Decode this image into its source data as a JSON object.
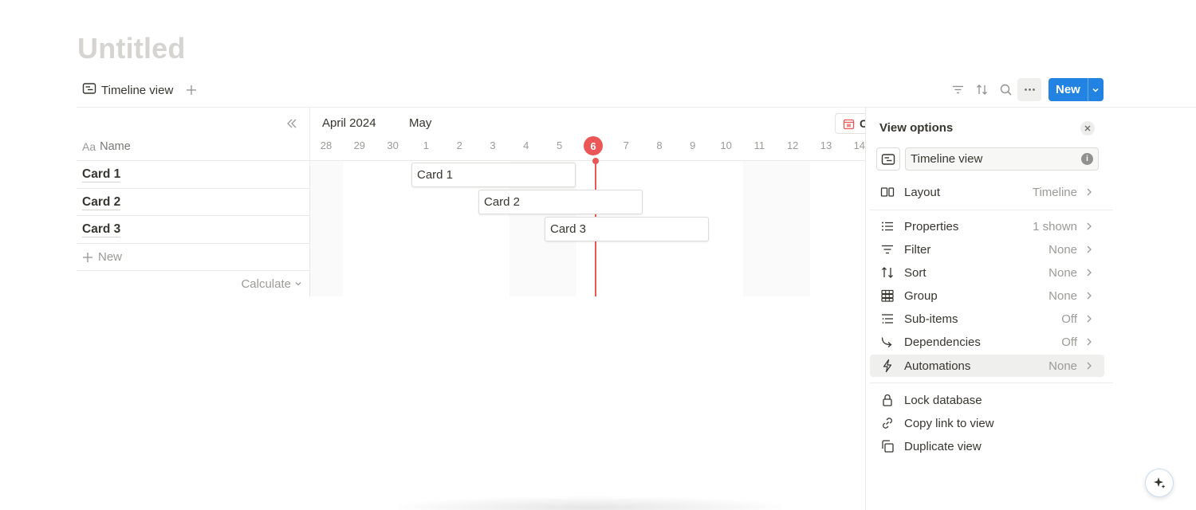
{
  "page": {
    "title": "Untitled"
  },
  "views": {
    "active_tab": "Timeline view",
    "add_icon": "plus-icon"
  },
  "toolbar": {
    "icons": [
      "filter-icon",
      "sort-icon",
      "search-icon",
      "more-icon"
    ],
    "new_label": "New",
    "accent": "#2383e2"
  },
  "table": {
    "name_prefix": "Aa",
    "name_header": "Name",
    "rows": [
      "Card 1",
      "Card 2",
      "Card 3"
    ],
    "new_label": "New",
    "calculate_label": "Calculate"
  },
  "timeline": {
    "months": [
      "April 2024",
      "May"
    ],
    "days": [
      "28",
      "29",
      "30",
      "1",
      "2",
      "3",
      "4",
      "5",
      "6",
      "7",
      "8",
      "9",
      "10",
      "11",
      "12",
      "13",
      "14"
    ],
    "today": "6",
    "today_color": "#eb5757",
    "calendar_button_label": "C",
    "cards": [
      {
        "label": "Card 1",
        "start": "May 1",
        "end": "May 5"
      },
      {
        "label": "Card 2",
        "start": "May 3",
        "end": "May 7"
      },
      {
        "label": "Card 3",
        "start": "May 5",
        "end": "May 9"
      }
    ]
  },
  "panel": {
    "title": "View options",
    "view_name": "Timeline view",
    "options_group1": [
      {
        "label": "Layout",
        "value": "Timeline",
        "icon": "layout-icon"
      }
    ],
    "options_group2": [
      {
        "label": "Properties",
        "value": "1 shown",
        "icon": "list-icon"
      },
      {
        "label": "Filter",
        "value": "None",
        "icon": "filter-icon"
      },
      {
        "label": "Sort",
        "value": "None",
        "icon": "sort-icon"
      },
      {
        "label": "Group",
        "value": "None",
        "icon": "grid-icon"
      },
      {
        "label": "Sub-items",
        "value": "Off",
        "icon": "subitems-icon"
      },
      {
        "label": "Dependencies",
        "value": "Off",
        "icon": "dependency-arrow-icon"
      },
      {
        "label": "Automations",
        "value": "None",
        "icon": "lightning-icon"
      }
    ],
    "actions": [
      {
        "label": "Lock database",
        "icon": "lock-icon"
      },
      {
        "label": "Copy link to view",
        "icon": "link-icon"
      },
      {
        "label": "Duplicate view",
        "icon": "duplicate-icon"
      }
    ]
  }
}
